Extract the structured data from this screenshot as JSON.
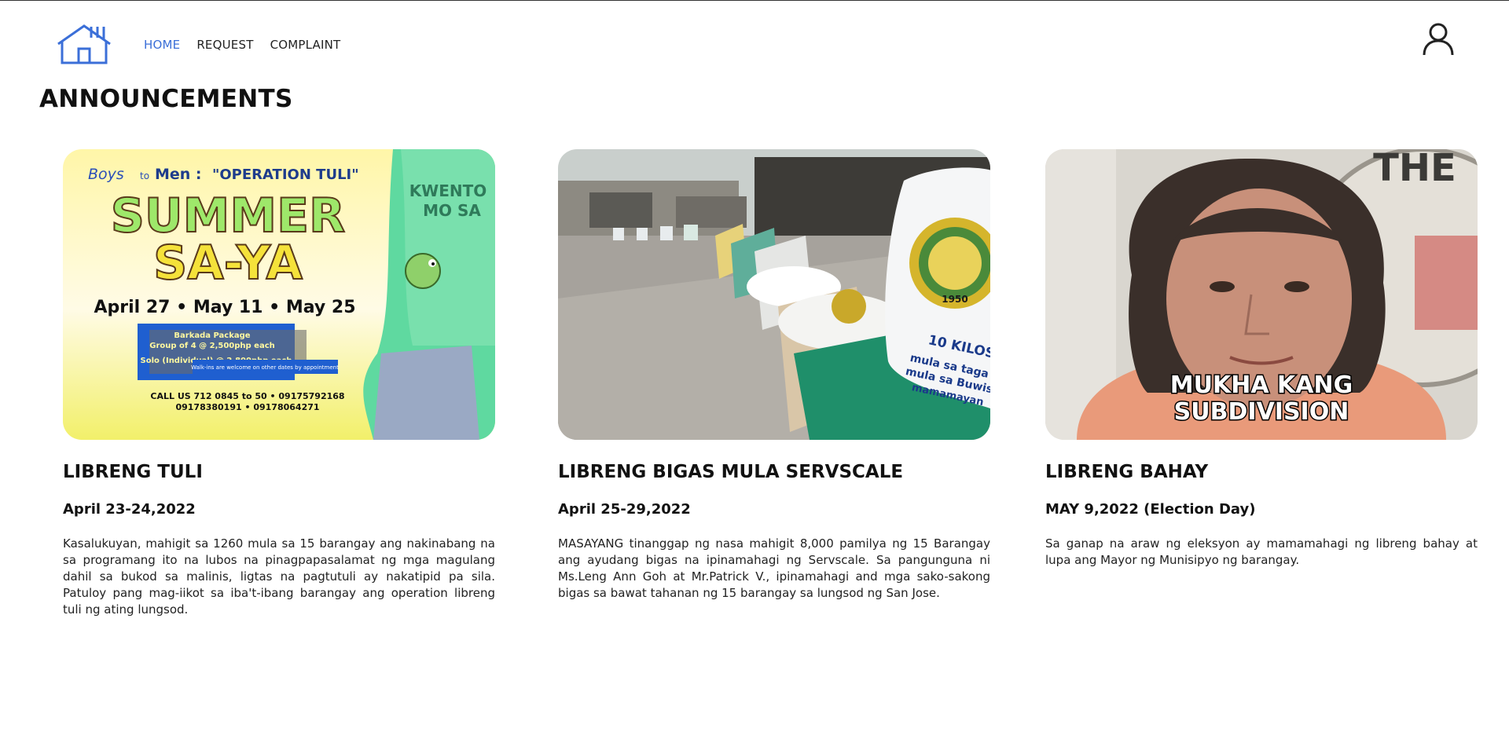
{
  "nav": {
    "links": [
      {
        "label": "HOME",
        "active": true
      },
      {
        "label": "REQUEST",
        "active": false
      },
      {
        "label": "COMPLAINT",
        "active": false
      }
    ]
  },
  "page": {
    "heading": "ANNOUNCEMENTS"
  },
  "colors": {
    "accent": "#3b6fd8",
    "text": "#111111"
  },
  "cards": [
    {
      "title": "LIBRENG TULI",
      "date": "April 23-24,2022",
      "description": "Kasalukuyan, mahigit sa 1260 mula sa 15 barangay ang nakinabang na sa programang ito na lubos na pinagpapasalamat ng mga magulang dahil sa bukod sa malinis, ligtas na pagtutuli ay nakatipid pa sila. Patuloy pang mag-iikot sa iba't-ibang barangay ang operation libreng tuli ng ating lungsod.",
      "poster": {
        "tagline_a": "Boys",
        "tagline_b": "to",
        "tagline_c": "Men :",
        "tagline_d": "\"OPERATION TULI\"",
        "headline_1": "SUMMER",
        "headline_2": "SA-YA",
        "dates": "April 27 • May 11 • May 25",
        "package_1": "Barkada Package",
        "package_2": "Group of 4 @ 2,500php each",
        "package_3": "Solo (Individual) @ 2,800php each",
        "walkin": "Walk-ins are welcome on other dates by appointment",
        "call_1": "CALL US 712 0845 to 50 • 09175792168",
        "call_2": "09178380191 • 09178064271",
        "shirt": "KWENTO",
        "shirt_2": "MO SA"
      }
    },
    {
      "title": "LIBRENG BIGAS MULA SERVSCALE",
      "date": "April 25-29,2022",
      "description": "MASAYANG tinanggap ng nasa mahigit 8,000 pamilya ng 15 Barangay ang ayudang bigas na ipinamahagi ng Servscale. Sa pangunguna ni Ms.Leng Ann Goh at Mr.Patrick V., ipinamahagi and mga sako-sakong bigas sa bawat tahanan ng 15 barangay sa lungsod ng San Jose.",
      "photo": {
        "sack_1": "10 KILOS",
        "sack_2": "mula sa taga Cabana",
        "sack_3": "mula sa Buwis ng",
        "sack_4": "mamamayan",
        "seal_year": "1950"
      }
    },
    {
      "title": "LIBRENG BAHAY",
      "date": "MAY 9,2022 (Election Day)",
      "description": "Sa ganap na araw ng eleksyon ay mamamahagi ng libreng bahay at lupa ang Mayor ng Munisipyo ng barangay.",
      "photo": {
        "caption_1": "MUKHA KANG",
        "caption_2": "SUBDIVISION",
        "seal_text": "THE"
      }
    }
  ]
}
